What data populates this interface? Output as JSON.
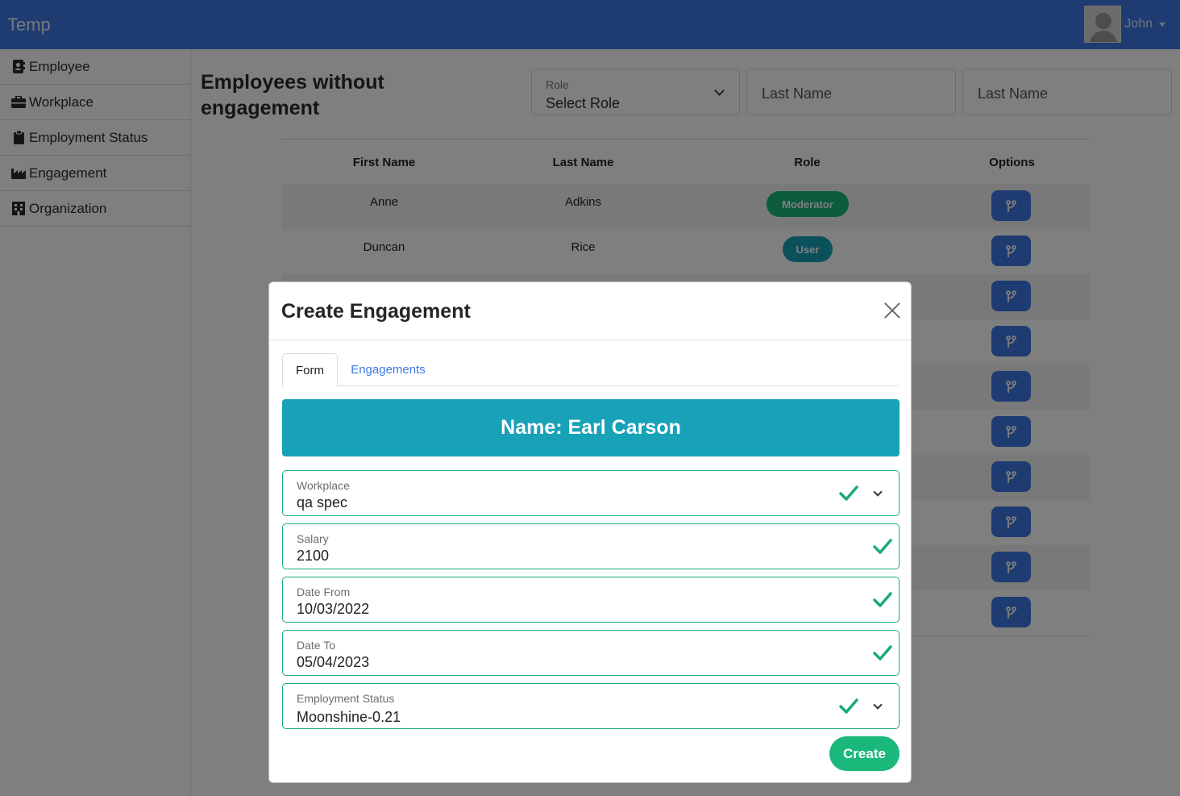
{
  "navbar": {
    "brand": "Temp",
    "user_name": "John"
  },
  "sidebar": {
    "items": [
      {
        "label": "Employee",
        "icon": "address-book-icon"
      },
      {
        "label": "Workplace",
        "icon": "briefcase-icon"
      },
      {
        "label": "Employment Status",
        "icon": "clipboard-icon"
      },
      {
        "label": "Engagement",
        "icon": "industry-icon"
      },
      {
        "label": "Organization",
        "icon": "building-icon"
      }
    ]
  },
  "main": {
    "title": "Employees without engagement",
    "filters": {
      "role": {
        "label": "Role",
        "value": "Select Role"
      },
      "last_name_1": "Last Name",
      "last_name_2": "Last Name"
    },
    "table": {
      "headers": [
        "First Name",
        "Last Name",
        "Role",
        "Options"
      ],
      "rows": [
        {
          "first": "Anne",
          "last": "Adkins",
          "role": "Moderator",
          "role_color": "#18b67a"
        },
        {
          "first": "Duncan",
          "last": "Rice",
          "role": "User",
          "role_color": "#17a2b8"
        }
      ],
      "option_button_icon": "code-branch-icon",
      "option_button_count": 10
    }
  },
  "modal": {
    "title": "Create Engagement",
    "tabs": {
      "form": "Form",
      "engagements": "Engagements"
    },
    "banner": "Name: Earl Carson",
    "fields": {
      "workplace": {
        "label": "Workplace",
        "value": "qa spec"
      },
      "salary": {
        "label": "Salary",
        "value": "2100"
      },
      "date_from": {
        "label": "Date From",
        "value": "10/03/2022"
      },
      "date_to": {
        "label": "Date To",
        "value": "05/04/2023"
      },
      "employment_status": {
        "label": "Employment Status",
        "value": "Moonshine-0.21"
      }
    },
    "create_label": "Create"
  },
  "colors": {
    "primary": "#3d78e3",
    "success": "#18b67a",
    "info": "#17a2b8"
  }
}
